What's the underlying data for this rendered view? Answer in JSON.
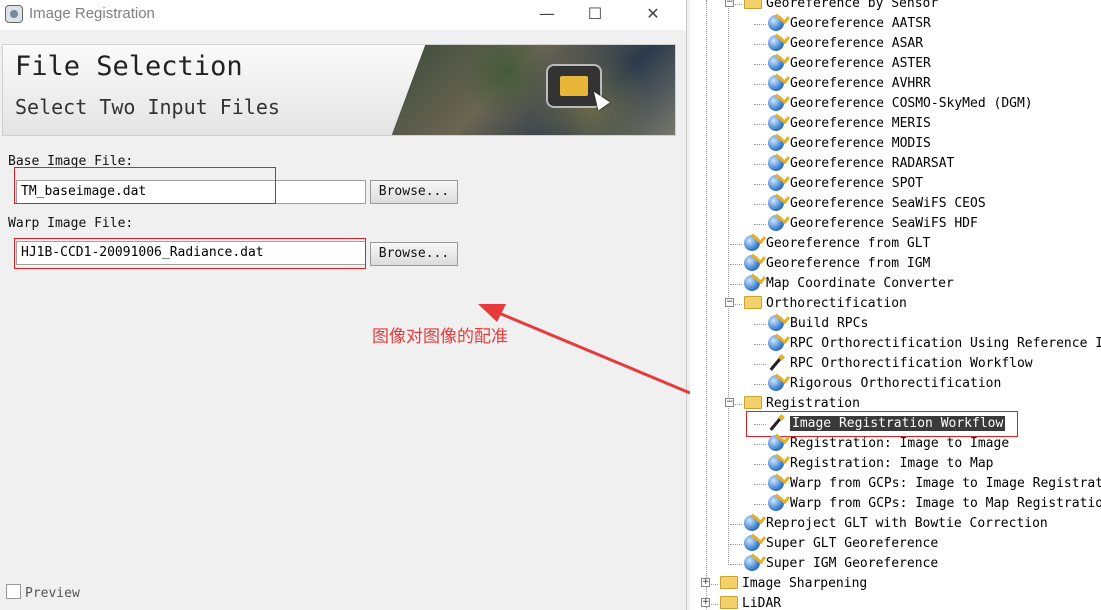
{
  "window": {
    "title": "Image Registration",
    "minimize_symbol": "—",
    "maximize_symbol": "☐",
    "close_symbol": "✕"
  },
  "banner": {
    "title": "File Selection",
    "subtitle": "Select Two Input Files"
  },
  "base_image": {
    "label": "Base Image File:",
    "value": "TM_baseimage.dat",
    "browse_label": "Browse..."
  },
  "warp_image": {
    "label": "Warp Image File:",
    "value": "HJ1B-CCD1-20091006_Radiance.dat",
    "browse_label": "Browse..."
  },
  "annotation": {
    "text": "图像对图像的配准",
    "color": "#e83a3a"
  },
  "preview": {
    "label": "Preview",
    "checked": false
  },
  "tree": {
    "items": [
      {
        "label": "Georeference by Sensor",
        "icon": "folder-icon",
        "level": 1,
        "expand": "minus"
      },
      {
        "label": "Georeference AATSR",
        "icon": "globe-icon",
        "level": 2
      },
      {
        "label": "Georeference ASAR",
        "icon": "globe-icon",
        "level": 2
      },
      {
        "label": "Georeference ASTER",
        "icon": "globe-icon",
        "level": 2
      },
      {
        "label": "Georeference AVHRR",
        "icon": "globe-icon",
        "level": 2
      },
      {
        "label": "Georeference COSMO-SkyMed (DGM)",
        "icon": "globe-icon",
        "level": 2
      },
      {
        "label": "Georeference MERIS",
        "icon": "globe-icon",
        "level": 2
      },
      {
        "label": "Georeference MODIS",
        "icon": "globe-icon",
        "level": 2
      },
      {
        "label": "Georeference RADARSAT",
        "icon": "globe-icon",
        "level": 2
      },
      {
        "label": "Georeference SPOT",
        "icon": "globe-icon",
        "level": 2
      },
      {
        "label": "Georeference SeaWiFS CEOS",
        "icon": "globe-icon",
        "level": 2
      },
      {
        "label": "Georeference SeaWiFS HDF",
        "icon": "globe-icon",
        "level": 2
      },
      {
        "label": "Georeference from GLT",
        "icon": "globe-icon",
        "level": 1
      },
      {
        "label": "Georeference from IGM",
        "icon": "globe-icon",
        "level": 1
      },
      {
        "label": "Map Coordinate Converter",
        "icon": "globe-icon",
        "level": 1
      },
      {
        "label": "Orthorectification",
        "icon": "folder-icon",
        "level": 1,
        "expand": "minus"
      },
      {
        "label": "Build RPCs",
        "icon": "globe-icon",
        "level": 2
      },
      {
        "label": "RPC Orthorectification Using Reference Im",
        "icon": "globe-icon",
        "level": 2
      },
      {
        "label": "RPC Orthorectification Workflow",
        "icon": "wand-icon",
        "level": 2
      },
      {
        "label": "Rigorous Orthorectification",
        "icon": "globe-icon",
        "level": 2
      },
      {
        "label": "Registration",
        "icon": "folder-icon",
        "level": 1,
        "expand": "minus"
      },
      {
        "label": "Image Registration Workflow",
        "icon": "wand-icon",
        "level": 2,
        "selected": true
      },
      {
        "label": "Registration: Image to Image",
        "icon": "globe-icon",
        "level": 2
      },
      {
        "label": "Registration: Image to Map",
        "icon": "globe-icon",
        "level": 2
      },
      {
        "label": "Warp from GCPs: Image to Image Registrati",
        "icon": "globe-icon",
        "level": 2
      },
      {
        "label": "Warp from GCPs: Image to Map Registration",
        "icon": "globe-icon",
        "level": 2
      },
      {
        "label": "Reproject GLT with Bowtie Correction",
        "icon": "globe-icon",
        "level": 1
      },
      {
        "label": "Super GLT Georeference",
        "icon": "globe-icon",
        "level": 1
      },
      {
        "label": "Super IGM Georeference",
        "icon": "globe-icon",
        "level": 1
      },
      {
        "label": "Image Sharpening",
        "icon": "folder-icon",
        "level": 0,
        "expand": "plus"
      },
      {
        "label": "LiDAR",
        "icon": "folder-icon",
        "level": 0,
        "expand": "plus"
      }
    ]
  }
}
